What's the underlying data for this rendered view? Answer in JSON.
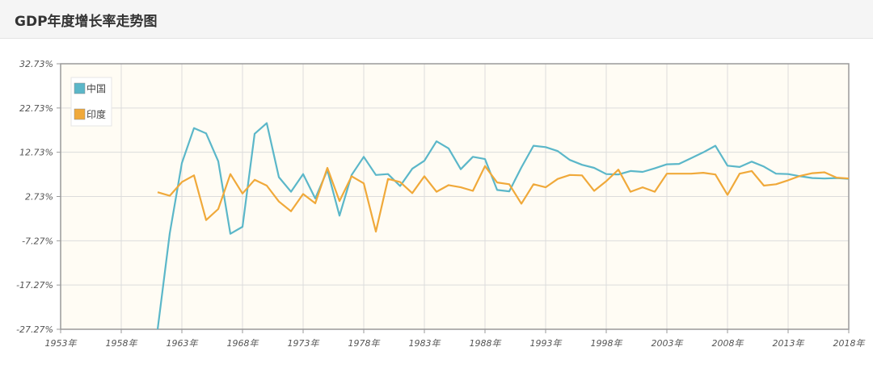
{
  "header": {
    "title": "GDP年度增长率走势图"
  },
  "chart_data": {
    "type": "line",
    "title": "",
    "xlabel": "",
    "ylabel": "",
    "xlim": [
      1953,
      2018
    ],
    "ylim": [
      -27.27,
      32.73
    ],
    "y_ticks": [
      32.73,
      22.73,
      12.73,
      2.73,
      -7.27,
      -17.27,
      -27.27
    ],
    "y_tick_labels": [
      "32.73%",
      "22.73%",
      "12.73%",
      "2.73%",
      "-7.27%",
      "-17.27%",
      "-27.27%"
    ],
    "x_ticks": [
      1953,
      1958,
      1963,
      1968,
      1973,
      1978,
      1983,
      1988,
      1993,
      1998,
      2003,
      2008,
      2013,
      2018
    ],
    "x_tick_labels": [
      "1953年",
      "1958年",
      "1963年",
      "1968年",
      "1973年",
      "1978年",
      "1983年",
      "1988年",
      "1993年",
      "1998年",
      "2003年",
      "2008年",
      "2013年",
      "2018年"
    ],
    "grid": true,
    "legend_position": "top-left",
    "series": [
      {
        "name": "中国",
        "color": "#5bb7c9",
        "x": [
          1961,
          1962,
          1963,
          1964,
          1965,
          1966,
          1967,
          1968,
          1969,
          1970,
          1971,
          1972,
          1973,
          1974,
          1975,
          1976,
          1977,
          1978,
          1979,
          1980,
          1981,
          1982,
          1983,
          1984,
          1985,
          1986,
          1987,
          1988,
          1989,
          1990,
          1991,
          1992,
          1993,
          1994,
          1995,
          1996,
          1997,
          1998,
          1999,
          2000,
          2001,
          2002,
          2003,
          2004,
          2005,
          2006,
          2007,
          2008,
          2009,
          2010,
          2011,
          2012,
          2013,
          2014,
          2015,
          2016,
          2017,
          2018
        ],
        "values": [
          -27.3,
          -5.6,
          10.3,
          18.2,
          17.0,
          10.7,
          -5.7,
          -4.1,
          16.9,
          19.3,
          7.1,
          3.8,
          7.8,
          2.3,
          8.7,
          -1.6,
          7.6,
          11.7,
          7.6,
          7.8,
          5.1,
          9.0,
          10.8,
          15.2,
          13.6,
          8.9,
          11.7,
          11.2,
          4.2,
          3.9,
          9.3,
          14.2,
          13.9,
          13.0,
          11.0,
          9.9,
          9.2,
          7.8,
          7.7,
          8.5,
          8.3,
          9.1,
          10.0,
          10.1,
          11.4,
          12.7,
          14.2,
          9.7,
          9.4,
          10.6,
          9.5,
          7.9,
          7.8,
          7.3,
          6.9,
          6.8,
          6.9,
          6.7
        ]
      },
      {
        "name": "印度",
        "color": "#f0a93a",
        "x": [
          1961,
          1962,
          1963,
          1964,
          1965,
          1966,
          1967,
          1968,
          1969,
          1970,
          1971,
          1972,
          1973,
          1974,
          1975,
          1976,
          1977,
          1978,
          1979,
          1980,
          1981,
          1982,
          1983,
          1984,
          1985,
          1986,
          1987,
          1988,
          1989,
          1990,
          1991,
          1992,
          1993,
          1994,
          1995,
          1996,
          1997,
          1998,
          1999,
          2000,
          2001,
          2002,
          2003,
          2004,
          2005,
          2006,
          2007,
          2008,
          2009,
          2010,
          2011,
          2012,
          2013,
          2014,
          2015,
          2016,
          2017,
          2018
        ],
        "values": [
          3.7,
          2.9,
          6.0,
          7.5,
          -2.6,
          -0.1,
          7.8,
          3.4,
          6.5,
          5.2,
          1.6,
          -0.6,
          3.3,
          1.2,
          9.2,
          1.7,
          7.3,
          5.7,
          -5.2,
          6.7,
          6.0,
          3.5,
          7.3,
          3.8,
          5.3,
          4.8,
          4.0,
          9.6,
          5.9,
          5.5,
          1.1,
          5.5,
          4.8,
          6.7,
          7.6,
          7.5,
          4.0,
          6.2,
          8.8,
          3.8,
          4.8,
          3.8,
          7.9,
          7.9,
          7.9,
          8.1,
          7.7,
          3.1,
          7.9,
          8.5,
          5.2,
          5.5,
          6.4,
          7.4,
          8.0,
          8.2,
          7.0,
          6.8
        ]
      }
    ]
  }
}
